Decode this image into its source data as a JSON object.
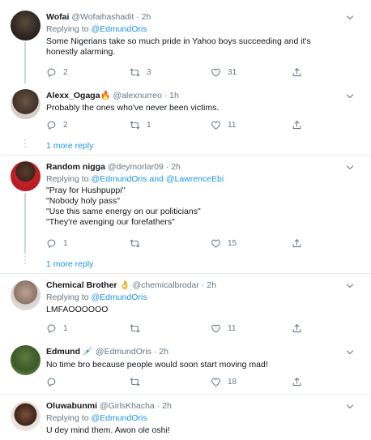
{
  "tweets": [
    {
      "name": "Wofai",
      "emoji": "",
      "handle": "@Wofaihashadit",
      "dot": "·",
      "time": "2h",
      "reply_prefix": "Replying to ",
      "reply_to": "@EdmundOris",
      "reply_and": "",
      "reply_to2": "",
      "lines": [
        "Some Nigerians take so much pride in Yahoo boys succeeding and it's",
        "honestly alarming."
      ],
      "replies": "2",
      "retweets": "3",
      "likes": "31"
    },
    {
      "name": "Alexx_Ogaga",
      "emoji": "🔥",
      "handle": "@alexnurreo",
      "dot": "·",
      "time": "1h",
      "lines": [
        "Probably the ones who've never been victims."
      ],
      "replies": "2",
      "retweets": "1",
      "likes": "11"
    },
    {
      "name": "Random nigga",
      "handle": "@deymorlar09",
      "dot": "·",
      "time": "2h",
      "reply_prefix": "Replying to ",
      "reply_to": "@EdmundOris",
      "reply_and": " and ",
      "reply_to2": "@LawrenceEbi",
      "lines": [
        "\"Pray for Hushpuppi\"",
        "\"Nobody holy pass\"",
        "\"Use this same energy on our politicians\"",
        "\"They're avenging our forefathers\""
      ],
      "replies": "1",
      "retweets": "",
      "likes": "15"
    },
    {
      "name": "Chemical Brother",
      "emoji": "👌",
      "handle": "@chemicalbrodar",
      "dot": "·",
      "time": "2h",
      "reply_prefix": "Replying to ",
      "reply_to": "@EdmundOris",
      "lines": [
        "LMFAOOOOOO"
      ],
      "replies": "1",
      "retweets": "",
      "likes": "11"
    },
    {
      "name": "Edmund",
      "emoji": "💉",
      "handle": "@EdmundOris",
      "dot": "·",
      "time": "2h",
      "lines": [
        "No time bro because people would soon start moving mad!"
      ],
      "replies": "",
      "retweets": "",
      "likes": "18"
    },
    {
      "name": "Oluwabunmi",
      "handle": "@GirlsKhacha",
      "dot": "·",
      "time": "2h",
      "reply_prefix": "Replying to ",
      "reply_to": "@EdmundOris",
      "lines": [
        "U dey mind them. Awon ole oshi!"
      ]
    }
  ],
  "more_reply_label": "1 more reply",
  "colors": {
    "link": "#1b95e0",
    "muted": "#657786",
    "border": "#e6ecf0"
  },
  "icons": [
    "reply-icon",
    "retweet-icon",
    "like-icon",
    "share-icon",
    "chevron-down-icon"
  ]
}
